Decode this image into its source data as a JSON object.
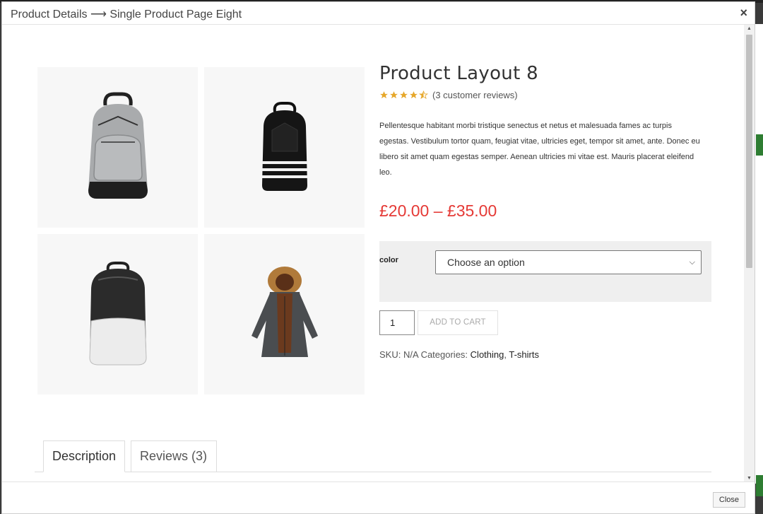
{
  "modal": {
    "title": "Product Details ⟶ Single Product Page Eight",
    "close_symbol": "×",
    "footer_close": "Close"
  },
  "product": {
    "title": "Product Layout 8",
    "rating": 4.5,
    "reviews_text": "(3 customer reviews)",
    "description": "Pellentesque habitant morbi tristique senectus et netus et malesuada fames ac turpis egestas. Vestibulum tortor quam, feugiat vitae, ultricies eget, tempor sit amet, ante. Donec eu libero sit amet quam egestas semper. Aenean ultricies mi vitae est. Mauris placerat eleifend leo.",
    "price": "£20.00 – £35.00",
    "variation": {
      "label": "color",
      "selected": "Choose an option"
    },
    "quantity": "1",
    "add_to_cart": "ADD TO CART",
    "meta": {
      "sku_label": "SKU:",
      "sku_value": "N/A",
      "categories_label": "Categories:",
      "categories": [
        "Clothing",
        "T-shirts"
      ]
    },
    "gallery": [
      {
        "icon": "gray-backpack-icon"
      },
      {
        "icon": "black-striped-backpack-icon"
      },
      {
        "icon": "black-white-backpack-icon"
      },
      {
        "icon": "fur-hood-parka-icon"
      }
    ]
  },
  "tabs": [
    {
      "label": "Description",
      "active": true
    },
    {
      "label": "Reviews (3)",
      "active": false
    }
  ],
  "colors": {
    "price": "#e53935",
    "star": "#e6a82c"
  }
}
